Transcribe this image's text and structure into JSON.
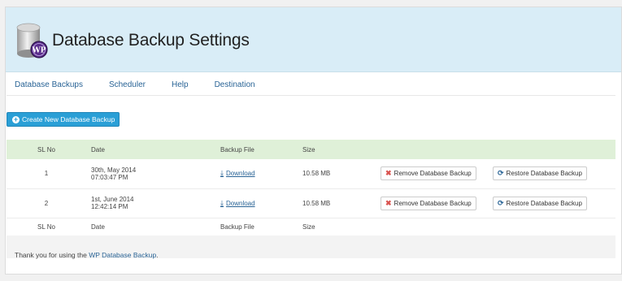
{
  "header": {
    "title": "Database Backup Settings",
    "logo_text": "WP"
  },
  "nav": [
    {
      "label": "Database Backups"
    },
    {
      "label": "Scheduler"
    },
    {
      "label": "Help"
    },
    {
      "label": "Destination"
    }
  ],
  "toolbar": {
    "create_label": "Create New Database Backup"
  },
  "table": {
    "columns": [
      "SL No",
      "Date",
      "Backup File",
      "Size"
    ],
    "rows": [
      {
        "sl": "1",
        "date_line1": "30th, May 2014",
        "date_line2": "07:03:47 PM",
        "file": "Download",
        "size": "10.58 MB",
        "remove": "Remove Database Backup",
        "restore": "Restore Database Backup"
      },
      {
        "sl": "2",
        "date_line1": "1st, June 2014",
        "date_line2": "12:42:14 PM",
        "file": "Download",
        "size": "10.58 MB",
        "remove": "Remove Database Backup",
        "restore": "Restore Database Backup"
      }
    ]
  },
  "footer": {
    "prefix": "Thank you for using the ",
    "link": "WP Database Backup",
    "suffix": "."
  },
  "colors": {
    "header_bg": "#d9edf7",
    "primary_button": "#2a9fd6",
    "table_header_bg": "#dff0d8",
    "remove_icon": "#d9534f",
    "link": "#2a6496"
  },
  "icons": {
    "create": "plus-circle-icon",
    "download": "download-icon",
    "remove": "times-icon",
    "restore": "refresh-icon",
    "logo": "database-icon"
  }
}
